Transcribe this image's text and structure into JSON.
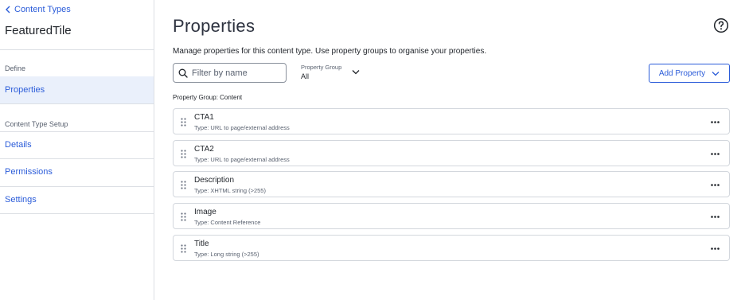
{
  "sidebar": {
    "back_label": "Content Types",
    "type_name": "FeaturedTile",
    "define_label": "Define",
    "define_items": [
      {
        "label": "Properties",
        "active": true
      }
    ],
    "setup_label": "Content Type Setup",
    "setup_items": [
      {
        "label": "Details"
      },
      {
        "label": "Permissions"
      },
      {
        "label": "Settings"
      }
    ]
  },
  "main": {
    "title": "Properties",
    "description": "Manage properties for this content type. Use property groups to organise your properties.",
    "filter": {
      "placeholder": "Filter by name",
      "value": ""
    },
    "property_group": {
      "label": "Property Group",
      "value": "All"
    },
    "add_button_label": "Add Property",
    "group_heading": "Property Group: Content",
    "properties": [
      {
        "name": "CTA1",
        "type": "Type: URL to page/external address"
      },
      {
        "name": "CTA2",
        "type": "Type: URL to page/external address"
      },
      {
        "name": "Description",
        "type": "Type: XHTML string (>255)"
      },
      {
        "name": "Image",
        "type": "Type: Content Reference"
      },
      {
        "name": "Title",
        "type": "Type: Long string (>255)"
      }
    ]
  },
  "colors": {
    "accent": "#2b5cd9",
    "active_nav_bg": "#eaf0fb",
    "border": "#d3d7dd"
  },
  "icons": {
    "back": "chevron-left-icon",
    "help": "question-circle-icon",
    "search": "search-icon",
    "dropdown": "chevron-down-icon",
    "drag": "drag-handle-icon",
    "more": "more-horizontal-icon"
  }
}
